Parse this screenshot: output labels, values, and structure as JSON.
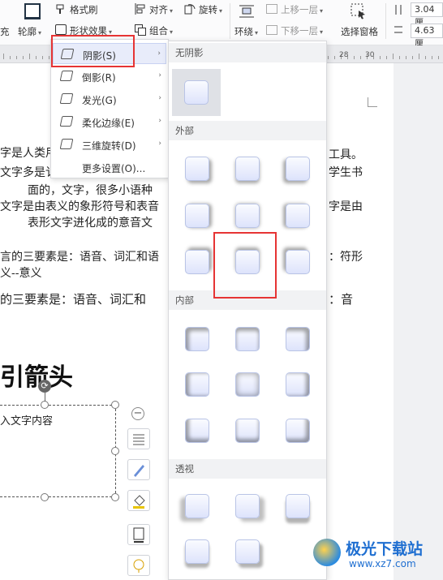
{
  "ribbon": {
    "format_brush": "格式刷",
    "align": "对齐",
    "rotate": "旋转",
    "move_up": "上移一层",
    "move_down": "下移一层",
    "wrap": "环绕",
    "group": "组合",
    "select_pane": "选择窗格",
    "outline": "轮廓",
    "shape_effects": "形状效果",
    "fill_frag": "充",
    "height_value": "3.04厘",
    "width_value": "4.63厘",
    "caret": "▾",
    "dropdown_caret": "▾"
  },
  "ruler": {
    "n28": "28",
    "n30": "30"
  },
  "document": {
    "lines": [
      "字是人类用",
      "文字多是讠",
      "面的，文字，很多小语种",
      "文字是由表义的象形符号和表音",
      "表形文字进化成的意音文",
      "言的三要素是：语音、词汇和语",
      "义--意义",
      "的三要素是：语音、词汇和",
      "工具。",
      "学生书",
      "字是由",
      "：符形",
      "：音"
    ],
    "heading": "引箭头",
    "textbox_text": "入文字内容"
  },
  "menu": {
    "items": [
      {
        "label": "阴影(S)"
      },
      {
        "label": "倒影(R)"
      },
      {
        "label": "发光(G)"
      },
      {
        "label": "柔化边缘(E)"
      },
      {
        "label": "三维旋转(D)"
      },
      {
        "label": "更多设置(O)..."
      }
    ],
    "arrow": "›"
  },
  "gallery": {
    "sections": {
      "none": "无阴影",
      "outer": "外部",
      "inner": "内部",
      "perspective": "透视"
    }
  },
  "side_tools": [
    "layout-options-icon",
    "shape-style-icon",
    "fill-icon",
    "outline-icon",
    "effect-icon"
  ],
  "watermark": {
    "title": "极光下载站",
    "url": "www.xz7.com"
  },
  "colors": {
    "highlight_red": "#e63434",
    "tile_blue": "#dde3fb",
    "selected_menu": "#e8ecfa"
  }
}
